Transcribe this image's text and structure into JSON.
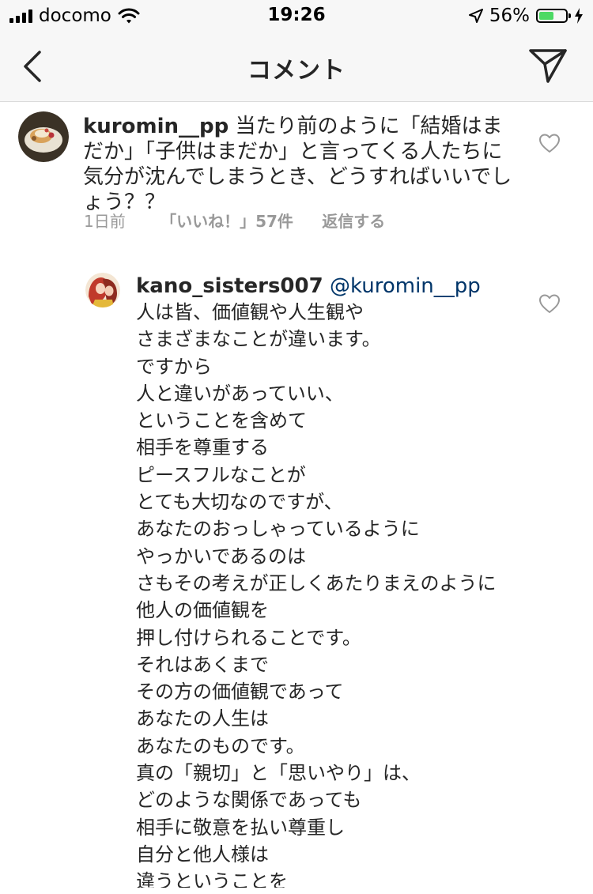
{
  "status_bar": {
    "carrier": "docomo",
    "time": "19:26",
    "battery_pct": "56%",
    "battery_level": 0.56
  },
  "nav": {
    "title": "コメント"
  },
  "comments": [
    {
      "username": "kuromin__pp",
      "text": "当たり前のように「結婚はまだか」「子供はまだか」と言ってくる人たちに気分が沈んでしまうとき、どうすればいいでしょう？？",
      "time": "1日前",
      "likes": "「いいね！」57件",
      "reply": "返信する"
    }
  ],
  "reply": {
    "username": "kano_sisters007",
    "mention": "@kuromin__pp",
    "lines": [
      "人は皆、価値観や人生観や",
      "さまざまなことが違います。",
      "ですから",
      "人と違いがあっていい、",
      "ということを含めて",
      "相手を尊重する",
      "ピースフルなことが",
      "とても大切なのですが、",
      "あなたのおっしゃっているように",
      "やっかいであるのは",
      "さもその考えが正しくあたりまえのように",
      "他人の価値観を",
      "押し付けられることです。",
      "それはあくまで",
      "その方の価値観であって",
      "あなたの人生は",
      "あなたのものです。",
      "真の「親切」と「思いやり」は、",
      "どのような関係であっても",
      "相手に敬意を払い尊重し",
      "自分と他人様は",
      "違うということを"
    ]
  }
}
